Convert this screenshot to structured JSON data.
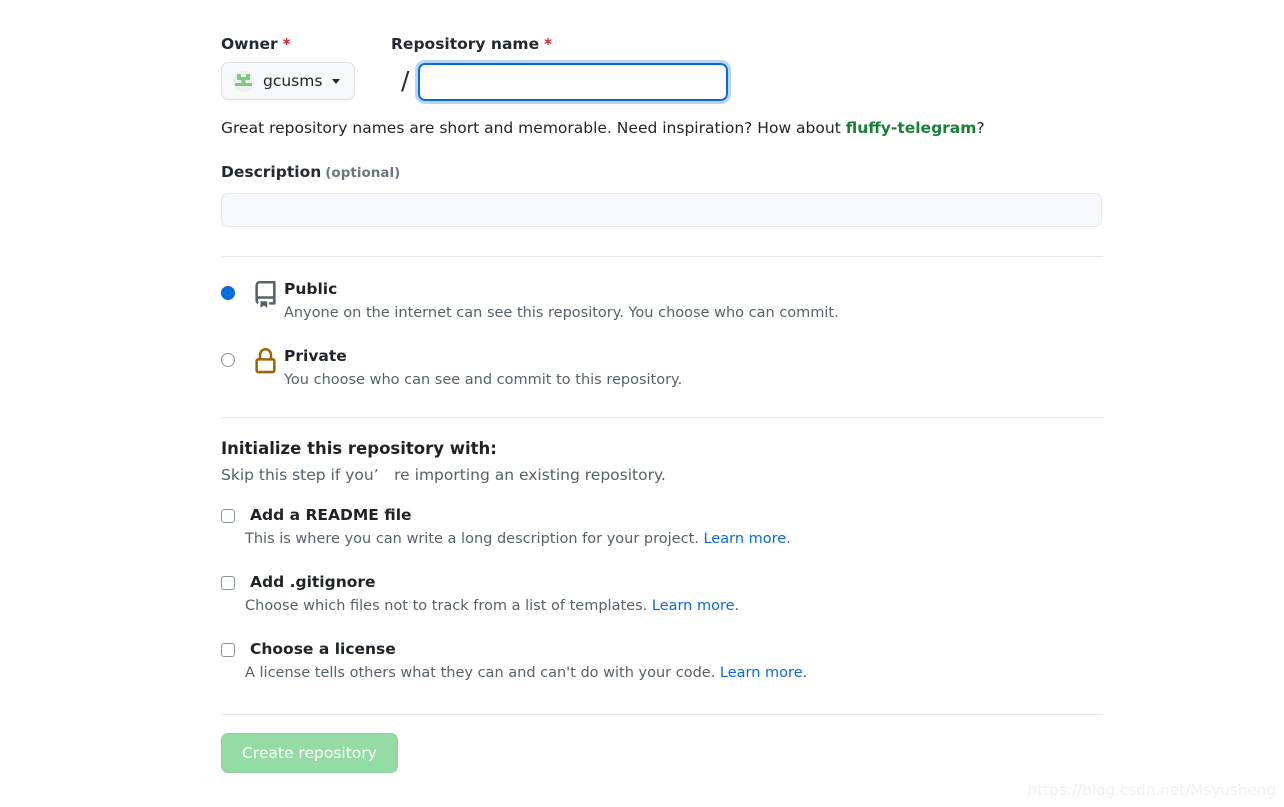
{
  "form": {
    "owner": {
      "label": "Owner",
      "required_mark": "*",
      "selected": "gcusms",
      "avatar_icon": "user-avatar-identicon",
      "caret_icon": "chevron-down-icon"
    },
    "separator": "/",
    "repository_name": {
      "label": "Repository name",
      "required_mark": "*",
      "value": "",
      "placeholder": ""
    },
    "hint": {
      "prefix": "Great repository names are short and memorable. Need inspiration? How about ",
      "suggestion": "fluffy-telegram",
      "suffix": "?"
    },
    "description": {
      "label": "Description",
      "optional_note": "(optional)",
      "value": "",
      "placeholder": ""
    },
    "visibility": {
      "options": [
        {
          "id": "public",
          "title": "Public",
          "description": "Anyone on the internet can see this repository. You choose who can commit.",
          "icon": "repo-book-icon",
          "icon_color": "#57606a",
          "selected": true
        },
        {
          "id": "private",
          "title": "Private",
          "description": "You choose who can see and commit to this repository.",
          "icon": "lock-icon",
          "icon_color": "#9a6700",
          "selected": false
        }
      ]
    },
    "initialize": {
      "title": "Initialize this repository with:",
      "subtitle": "Skip this step if you’　re importing an existing repository.",
      "items": [
        {
          "id": "readme",
          "label": "Add a README file",
          "description": "This is where you can write a long description for your project. ",
          "link_text": "Learn more",
          "description_suffix": ".",
          "checked": false
        },
        {
          "id": "gitignore",
          "label": "Add .gitignore",
          "description": "Choose which files not to track from a list of templates. ",
          "link_text": "Learn more",
          "description_suffix": ".",
          "checked": false
        },
        {
          "id": "license",
          "label": "Choose a license",
          "description": "A license tells others what they can and can't do with your code. ",
          "link_text": "Learn more",
          "description_suffix": ".",
          "checked": false
        }
      ]
    },
    "submit": {
      "label": "Create repository",
      "disabled": true,
      "color": "#94dba5"
    }
  },
  "watermark": "https://blog.csdn.net/Msyusheng",
  "colors": {
    "focus_border": "#0969da",
    "focus_ring": "#b6d6f7",
    "link": "#0969da",
    "suggestion_green": "#1a7f37",
    "required_red": "#cf222e",
    "muted_text": "#57606a",
    "divider": "#e6e8eb"
  }
}
